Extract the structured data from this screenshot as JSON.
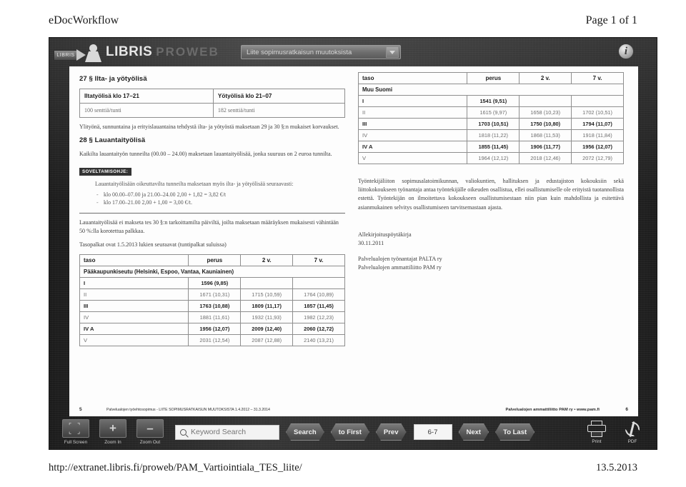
{
  "browser": {
    "header_title": "eDocWorkflow",
    "header_page": "Page 1 of 1",
    "footer_url": "http://extranet.libris.fi/proweb/PAM_Vartiointiala_TES_liite/",
    "footer_date": "13.5.2013"
  },
  "viewer": {
    "brand_badge": "LIBRIS",
    "brand_name": "LIBRIS",
    "brand_sub": "PROWEB",
    "document_select": {
      "value": "Liite sopimusratkaisun muutoksista",
      "options": [
        "Liite sopimusratkaisun muutoksista"
      ]
    },
    "info_label": "i"
  },
  "toolbar": {
    "full_screen": "Full Screen",
    "zoom_in": "Zoom In",
    "zoom_out": "Zoom Out",
    "search_placeholder": "Keyword Search",
    "search_value": "",
    "search_button": "Search",
    "to_first": "to First",
    "prev": "Prev",
    "page_value": "6-7",
    "next": "Next",
    "to_last": "To Last",
    "print": "Print",
    "pdf": "PDF"
  },
  "document": {
    "left": {
      "section27_title": "27 § Ilta- ja yötyölisä",
      "lisa_table": {
        "headers": [
          "Iltatyölisä klo 17–21",
          "Yötyölisä klo 21–07"
        ],
        "values": [
          "100 senttiä/tunti",
          "182 senttiä/tunti"
        ]
      },
      "para_after_lisa": "Ylityönä, sunnuntaina ja erityislauantaina tehdystä ilta- ja yötyöstä maksetaan 29 ja 30 §:n mukaiset korvaukset.",
      "section28_title": "28 § Lauantaityölisä",
      "para_28": "Kaikilta lauantaityön tunneilta (00.00 – 24.00) maksetaan lauantaityölisää, jonka suuruus on 2 euroa tunnilta.",
      "ohje_tag": "SOVELTAMISOHJE:",
      "ohje_intro": "Lauantaityölisään oikeuttavilta tunneilta maksetaan myös ilta- ja yötyölisää seuraavasti:",
      "ohje_items": [
        "klo 00.00–07.00 ja 21.00–24.00 2,00 + 1,82 = 3,82 €/t",
        "klo 17.00–21.00 2,00 + 1,00 = 3,00 €/t."
      ],
      "para_not_paid": "Lauantaityölisää ei makseta tes 30 §:n tarkoittamilta päiviltä, joilta maksetaan määräyksen mukaisesti vähintään 50 %:lla korotettua palkkaa.",
      "para_tasopalkat": "Tasopalkat ovat 1.5.2013 lukien seuraavat (tuntipalkat suluissa)",
      "pay_table": {
        "headers": [
          "taso",
          "perus",
          "2 v.",
          "7 v."
        ],
        "group": "Pääkaupunkiseutu (Helsinki, Espoo, Vantaa, Kauniainen)",
        "rows": [
          {
            "level": "I",
            "perus": "1596 (9,85)",
            "y2": "",
            "y7": ""
          },
          {
            "level": "II",
            "perus": "1671 (10,31)",
            "y2": "1715 (10,59)",
            "y7": "1764 (10,89)"
          },
          {
            "level": "III",
            "perus": "1763 (10,88)",
            "y2": "1809 (11,17)",
            "y7": "1857 (11,45)"
          },
          {
            "level": "IV",
            "perus": "1881 (11,61)",
            "y2": "1932 (11,93)",
            "y7": "1982 (12,23)"
          },
          {
            "level": "IV A",
            "perus": "1956 (12,07)",
            "y2": "2009 (12,40)",
            "y7": "2060 (12,72)"
          },
          {
            "level": "V",
            "perus": "2031 (12,54)",
            "y2": "2087 (12,88)",
            "y7": "2140 (13,21)"
          }
        ]
      }
    },
    "right": {
      "pay_table": {
        "headers": [
          "taso",
          "perus",
          "2 v.",
          "7 v."
        ],
        "group": "Muu Suomi",
        "rows": [
          {
            "level": "I",
            "perus": "1541 (9,51)",
            "y2": "",
            "y7": ""
          },
          {
            "level": "II",
            "perus": "1615 (9,97)",
            "y2": "1658 (10,23)",
            "y7": "1702 (10,51)"
          },
          {
            "level": "III",
            "perus": "1703 (10,51)",
            "y2": "1750 (10,80)",
            "y7": "1794 (11,07)"
          },
          {
            "level": "IV",
            "perus": "1818 (11,22)",
            "y2": "1868 (11,53)",
            "y7": "1918 (11,84)"
          },
          {
            "level": "IV A",
            "perus": "1855 (11,45)",
            "y2": "1906 (11,77)",
            "y7": "1956 (12,07)"
          },
          {
            "level": "V",
            "perus": "1964 (12,12)",
            "y2": "2018 (12,46)",
            "y7": "2072 (12,79)"
          }
        ]
      },
      "para_meetings": "Työntekijäliiton sopimusalatoimikunnan, valiokuntien, hallituksen ja edustajiston kokouksiin sekä liittokokoukseen työnantaja antaa työntekijälle oikeuden osallistua, ellei osallistumiselle ole erityistä tuotannollista estettä. Työntekijän on ilmoitettava kokoukseen osallistumisestaan niin pian kuin mahdollista ja esitettävä asianmukainen selvitys osallistumiseen tarvitsemastaan ajasta.",
      "sig_title": "Allekirjoituspöytäkirja",
      "sig_date": "30.11.2011",
      "sig_party1": "Palvelualojen työnantajat PALTA ry",
      "sig_party2": "Palvelualojen ammattiliitto PAM ry"
    },
    "footer": {
      "page_left": "5",
      "text_left": "Palvelualojen työehtosopimus - LIITE SOPIMUSRATKAISUN MUUTOKSISTA 1.4.2012 – 31.3.2014",
      "text_right": "Palvelualojen ammattiliitto PAM ry • www.pam.fi",
      "page_right": "6"
    }
  }
}
